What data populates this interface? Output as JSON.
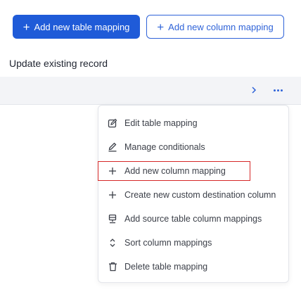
{
  "toolbar": {
    "add_table_mapping_label": "Add new table mapping",
    "add_column_mapping_label": "Add new column mapping"
  },
  "section": {
    "title": "Update existing record"
  },
  "row": {
    "expand_icon": "chevron-right-icon",
    "more_icon": "more-horizontal-icon"
  },
  "menu": {
    "items": [
      {
        "label": "Edit table mapping",
        "icon": "edit-icon"
      },
      {
        "label": "Manage conditionals",
        "icon": "pencil-icon"
      },
      {
        "label": "Add new column mapping",
        "icon": "plus-icon",
        "highlighted": true
      },
      {
        "label": "Create new custom destination column",
        "icon": "plus-icon"
      },
      {
        "label": "Add source table column mappings",
        "icon": "database-icon"
      },
      {
        "label": "Sort column mappings",
        "icon": "sort-icon"
      },
      {
        "label": "Delete table mapping",
        "icon": "trash-icon"
      }
    ]
  },
  "colors": {
    "primary": "#1f5bd8",
    "highlight_border": "#d62828",
    "row_band": "#f3f4f7"
  }
}
